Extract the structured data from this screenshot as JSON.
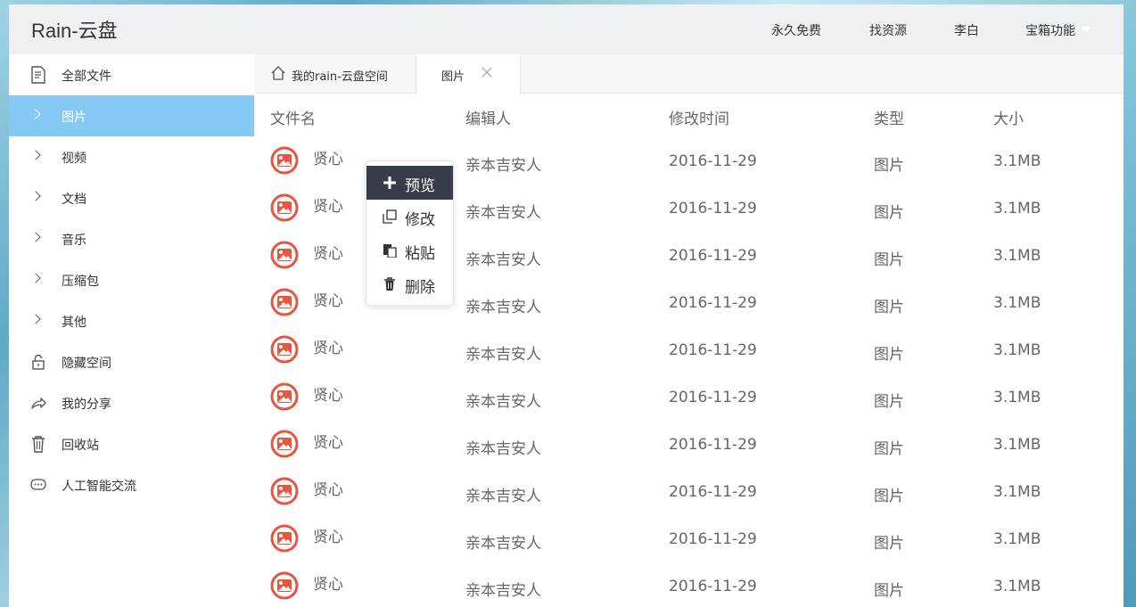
{
  "app": {
    "title": "Rain-云盘"
  },
  "topnav": {
    "items": [
      "永久免费",
      "找资源",
      "李白",
      "宝箱功能"
    ]
  },
  "sidebar": {
    "items": [
      {
        "label": "全部文件",
        "icon": "file-icon"
      },
      {
        "label": "图片",
        "icon": "chevron-right-icon",
        "active": true
      },
      {
        "label": "视频",
        "icon": "chevron-right-icon"
      },
      {
        "label": "文档",
        "icon": "chevron-right-icon"
      },
      {
        "label": "音乐",
        "icon": "chevron-right-icon"
      },
      {
        "label": "压缩包",
        "icon": "chevron-right-icon"
      },
      {
        "label": "其他",
        "icon": "chevron-right-icon"
      },
      {
        "label": "隐藏空间",
        "icon": "lock-icon"
      },
      {
        "label": "我的分享",
        "icon": "share-icon"
      },
      {
        "label": "回收站",
        "icon": "trash-icon"
      },
      {
        "label": "人工智能交流",
        "icon": "chat-icon"
      }
    ]
  },
  "tabs": {
    "home": "我的rain-云盘空间",
    "current": "图片"
  },
  "table": {
    "headers": [
      "文件名",
      "编辑人",
      "修改时间",
      "类型",
      "大小"
    ],
    "rows": [
      {
        "name": "贤心",
        "editor": "亲本吉安人",
        "date": "2016-11-29",
        "type": "图片",
        "size": "3.1MB"
      },
      {
        "name": "贤心",
        "editor": "亲本吉安人",
        "date": "2016-11-29",
        "type": "图片",
        "size": "3.1MB"
      },
      {
        "name": "贤心",
        "editor": "亲本吉安人",
        "date": "2016-11-29",
        "type": "图片",
        "size": "3.1MB"
      },
      {
        "name": "贤心",
        "editor": "亲本吉安人",
        "date": "2016-11-29",
        "type": "图片",
        "size": "3.1MB"
      },
      {
        "name": "贤心",
        "editor": "亲本吉安人",
        "date": "2016-11-29",
        "type": "图片",
        "size": "3.1MB"
      },
      {
        "name": "贤心",
        "editor": "亲本吉安人",
        "date": "2016-11-29",
        "type": "图片",
        "size": "3.1MB"
      },
      {
        "name": "贤心",
        "editor": "亲本吉安人",
        "date": "2016-11-29",
        "type": "图片",
        "size": "3.1MB"
      },
      {
        "name": "贤心",
        "editor": "亲本吉安人",
        "date": "2016-11-29",
        "type": "图片",
        "size": "3.1MB"
      },
      {
        "name": "贤心",
        "editor": "亲本吉安人",
        "date": "2016-11-29",
        "type": "图片",
        "size": "3.1MB"
      },
      {
        "name": "贤心",
        "editor": "亲本吉安人",
        "date": "2016-11-29",
        "type": "图片",
        "size": "3.1MB"
      }
    ]
  },
  "context_menu": {
    "items": [
      {
        "label": "预览",
        "icon": "plus-icon",
        "highlighted": true
      },
      {
        "label": "修改",
        "icon": "copy-icon"
      },
      {
        "label": "粘贴",
        "icon": "paste-icon"
      },
      {
        "label": "删除",
        "icon": "trash-icon"
      }
    ]
  },
  "colors": {
    "accent": "#87c9f5",
    "file_icon": "#e8553e",
    "menu_highlight": "#393d49",
    "header_bg": "#eef0f3"
  }
}
